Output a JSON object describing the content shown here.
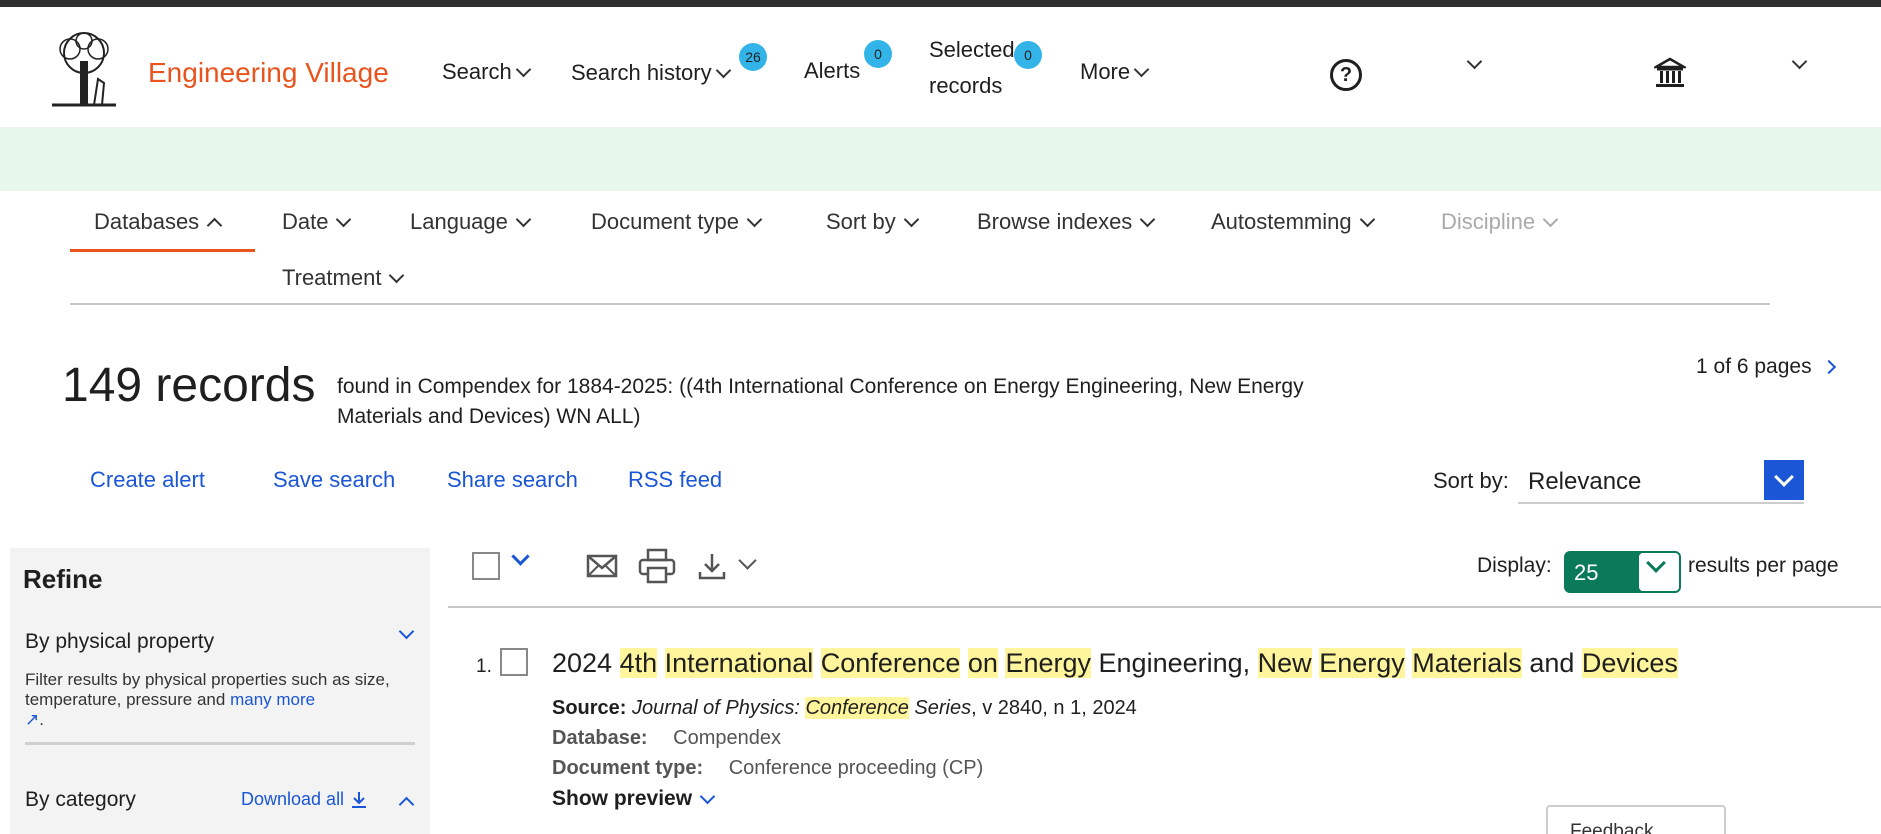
{
  "header": {
    "brand": "Engineering Village",
    "nav": {
      "search": "Search",
      "search_history": "Search history",
      "search_history_count": "26",
      "alerts": "Alerts",
      "alerts_count": "0",
      "selected_line1": "Selected",
      "selected_line2": "records",
      "selected_count": "0",
      "more": "More"
    },
    "help_glyph": "?"
  },
  "filters": {
    "items": [
      "Databases",
      "Date",
      "Language",
      "Document type",
      "Sort by",
      "Browse indexes",
      "Autostemming",
      "Discipline",
      "Treatment"
    ]
  },
  "results_summary": {
    "count": "149 records",
    "query_text": "found in Compendex for 1884-2025: ((4th International Conference on Energy Engineering, New Energy Materials and Devices) WN ALL)",
    "pages": "1 of 6 pages"
  },
  "actions": {
    "create_alert": "Create alert",
    "save_search": "Save search",
    "share_search": "Share search",
    "rss_feed": "RSS feed"
  },
  "sort": {
    "label": "Sort by:",
    "value": "Relevance"
  },
  "refine": {
    "title": "Refine",
    "physical_property": "By physical property",
    "physical_desc": "Filter results by physical properties such as size, temperature, pressure and",
    "many_more": "many more",
    "by_category": "By category",
    "download_all": "Download all"
  },
  "display": {
    "label": "Display:",
    "value": "25",
    "suffix": "results per page"
  },
  "result": {
    "number": "1.",
    "title_words": [
      "2024",
      "4th",
      "International",
      "Conference",
      "on",
      "Energy",
      "Engineering,",
      "New",
      "Energy",
      "Materials",
      "and",
      "Devices"
    ],
    "source_label": "Source:",
    "source_journal_a": "Journal of Physics:",
    "source_journal_hl": "Conference",
    "source_journal_b": "Series",
    "source_rest": ", v 2840, n 1, 2024",
    "database_label": "Database:",
    "database_value": "Compendex",
    "doctype_label": "Document type:",
    "doctype_value": "Conference proceeding (CP)",
    "show_preview": "Show preview"
  },
  "feedback": "Feedback",
  "colors": {
    "brand": "#e9531d",
    "link": "#1a56d6",
    "badge": "#33b4e8",
    "highlight": "#fff59d",
    "display_select": "#0a7a5a",
    "banner": "#e8f7ec"
  }
}
